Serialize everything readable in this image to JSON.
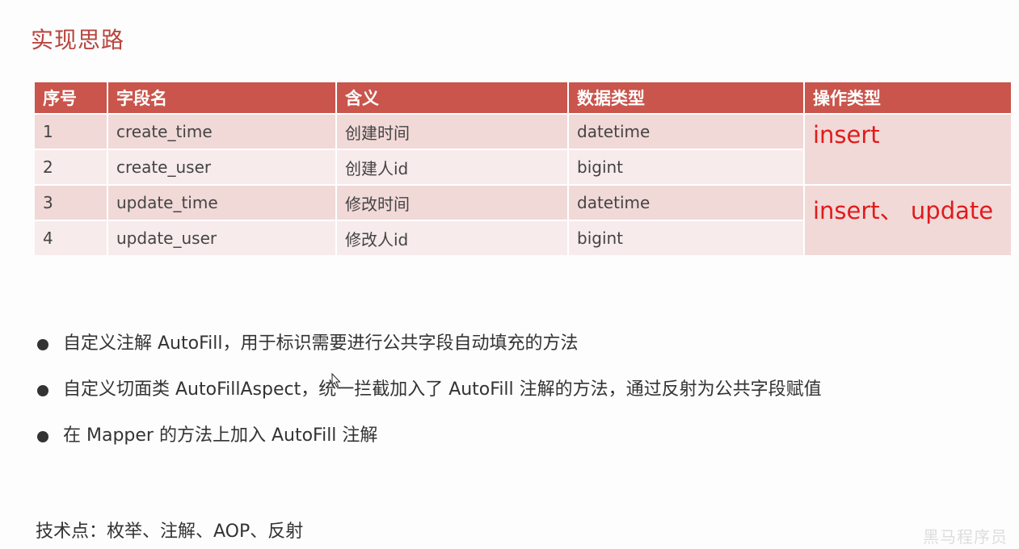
{
  "title": "实现思路",
  "table": {
    "headers": [
      "序号",
      "字段名",
      "含义",
      "数据类型",
      "操作类型"
    ],
    "rows": [
      {
        "no": "1",
        "field": "create_time",
        "meaning": "创建时间",
        "type": "datetime"
      },
      {
        "no": "2",
        "field": "create_user",
        "meaning": "创建人id",
        "type": "bigint"
      },
      {
        "no": "3",
        "field": "update_time",
        "meaning": "修改时间",
        "type": "datetime"
      },
      {
        "no": "4",
        "field": "update_user",
        "meaning": "修改人id",
        "type": "bigint"
      }
    ],
    "operations": [
      "insert",
      "insert、 update"
    ]
  },
  "bullets": [
    "自定义注解 AutoFill，用于标识需要进行公共字段自动填充的方法",
    "自定义切面类 AutoFillAspect，统一拦截加入了 AutoFill 注解的方法，通过反射为公共字段赋值",
    "在 Mapper 的方法上加入 AutoFill 注解"
  ],
  "tech_points": "技术点：枚举、注解、AOP、反射",
  "watermark": "黑马程序员"
}
